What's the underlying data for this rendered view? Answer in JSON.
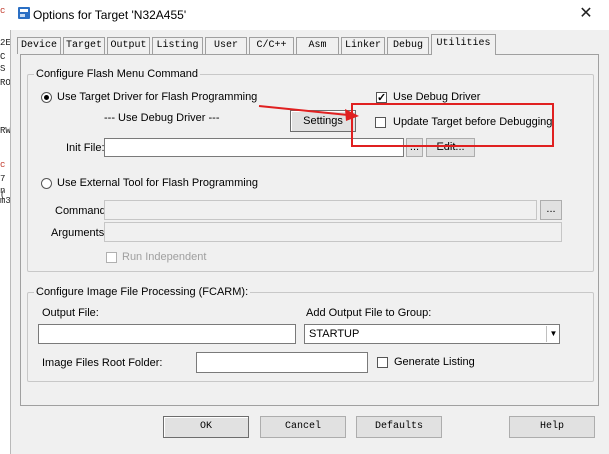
{
  "window": {
    "title": "Options for Target 'N32A455'",
    "close_glyph": "✕",
    "icon": "keil-window-icon"
  },
  "left_code": {
    "fragments": [
      "c",
      "2E",
      "C",
      "S",
      "RO",
      "",
      "RW",
      "",
      "c",
      "7",
      "n",
      "(",
      "m3"
    ]
  },
  "tabs": [
    {
      "label": "Device"
    },
    {
      "label": "Target"
    },
    {
      "label": "Output"
    },
    {
      "label": "Listing"
    },
    {
      "label": "User"
    },
    {
      "label": "C/C++"
    },
    {
      "label": "Asm"
    },
    {
      "label": "Linker"
    },
    {
      "label": "Debug"
    },
    {
      "label": "Utilities",
      "active": true
    }
  ],
  "flash_group": {
    "legend": "Configure Flash Menu Command",
    "use_target_driver": {
      "label": "Use Target Driver for Flash Programming",
      "selected": true
    },
    "use_debug_driver_text": "--- Use Debug Driver ---",
    "settings_button": "Settings",
    "use_debug_driver_check": {
      "label": "Use Debug Driver",
      "checked": true
    },
    "update_target_check": {
      "label": "Update Target before Debugging",
      "checked": false
    },
    "init_file_label": "Init File:",
    "init_file_value": "",
    "browse_button": "...",
    "edit_button": "Edit...",
    "use_external_tool": {
      "label": "Use External Tool for Flash Programming",
      "selected": false
    },
    "command_label": "Command:",
    "command_value": "",
    "command_browse": "...",
    "arguments_label": "Arguments:",
    "arguments_value": "",
    "run_independent": {
      "label": "Run Independent",
      "checked": false
    }
  },
  "image_group": {
    "legend": "Configure Image File Processing (FCARM):",
    "output_file_label": "Output File:",
    "output_file_value": "",
    "add_output_label": "Add Output File  to Group:",
    "group_selected": "STARTUP",
    "root_folder_label": "Image Files Root Folder:",
    "root_folder_value": "",
    "generate_listing": {
      "label": "Generate Listing",
      "checked": false
    }
  },
  "footer": {
    "ok": "OK",
    "cancel": "Cancel",
    "defaults": "Defaults",
    "help": "Help"
  },
  "colors": {
    "annotation": "#e02020",
    "dialog_bg": "#f0f0f0"
  }
}
